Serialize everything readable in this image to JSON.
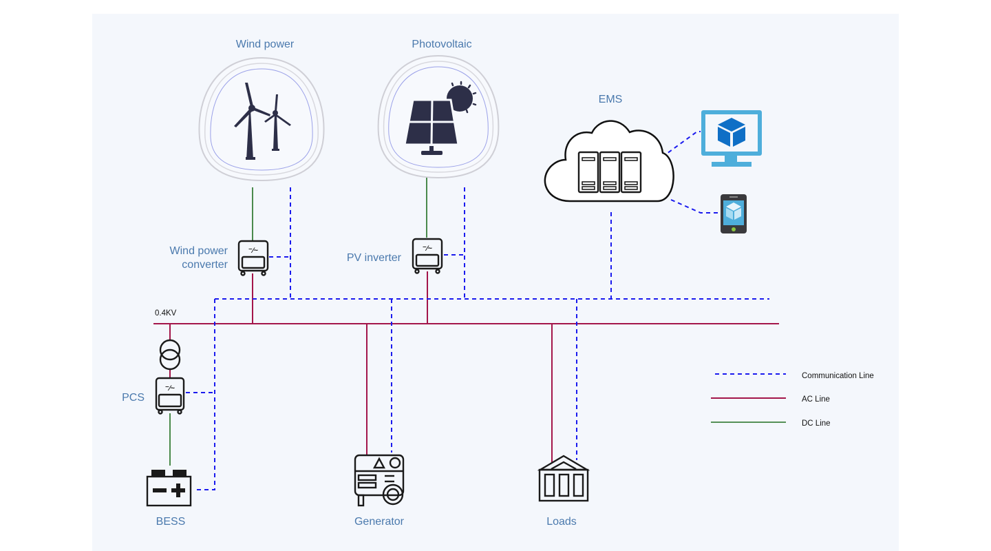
{
  "labels": {
    "wind_power": "Wind power",
    "photovoltaic": "Photovoltaic",
    "ems": "EMS",
    "wind_converter_line1": "Wind power",
    "wind_converter_line2": "converter",
    "pv_inverter": "PV inverter",
    "bus_voltage": "0.4KV",
    "pcs": "PCS",
    "bess": "BESS",
    "generator": "Generator",
    "loads": "Loads"
  },
  "legend": [
    {
      "label": "Communication Line",
      "style": "dashed",
      "color": "#1a1aee"
    },
    {
      "label": "AC Line",
      "style": "solid",
      "color": "#a3154a"
    },
    {
      "label": "DC Line",
      "style": "solid",
      "color": "#1f6e1f"
    }
  ],
  "colors": {
    "background": "#f4f7fc",
    "label_text": "#4a79ad",
    "communication_line": "#1a1aee",
    "ac_line": "#a3154a",
    "dc_line": "#1f6e1f",
    "icon_dark": "#2d2f48",
    "device_blue": "#4eaedb"
  }
}
